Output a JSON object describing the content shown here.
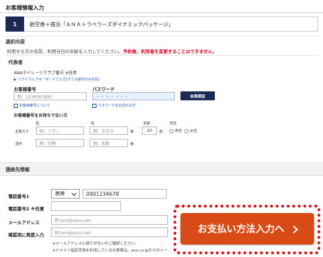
{
  "header": {
    "title": "お客様情報入力"
  },
  "step": {
    "number": "1",
    "label": "航空券＋宿泊「ＡＮＡトラベラーズダイナミックパッケージ」"
  },
  "selection": {
    "heading": "選択内容",
    "description": "利用する方の名前、利用当日の年齢を入力してください。",
    "warning": "予約後、利用者を変更することはできません。"
  },
  "representative": {
    "heading": "代表者",
    "amc_label": "ANAマイレージクラブ番号 ※任意",
    "keyboard_link": "ソフトウェアキーボードで入力(マウス操作のみ対応)",
    "member_number_label": "お客様番号",
    "member_number_placeholder": "例：1234567890",
    "password_label": "パスワード",
    "password_value": "・・・・・・・",
    "auth_button": "会員認証",
    "forgot_number_link": "お客様番号について",
    "forgot_password_link": "パスワードをお忘れの方",
    "no_number_label": "お客様番号をお持ちでない方",
    "col_last": "姓",
    "col_first": "名",
    "col_age": "年齢",
    "col_gender": "性別",
    "kana_label": "全角カナ",
    "kana_last_placeholder": "例：ソラノ",
    "kana_first_placeholder": "例：タロウ",
    "kanji_label": "漢字",
    "kanji_last_placeholder": "例：空野",
    "kanji_first_placeholder": "例：太郎",
    "age_value": "20",
    "age_unit": "歳",
    "honorific": "様",
    "gender_male": "男性",
    "gender_female": "女性"
  },
  "contact": {
    "heading": "連絡先情報",
    "phone1_label": "電話番号1",
    "phone_type": "携帯",
    "phone1_value": "0901234678",
    "phone2_label": "電話番号2 ※任意",
    "email_label": "メールアドレス",
    "email_value": "例 taro@sora.com",
    "email_confirm_label": "確認用に再度入力",
    "email_confirm_value": "例 taro@sora.com",
    "note1": "※メールアドレスに誤りがないかご確認ください。",
    "note2": "※ドメイン指定受信を利用しているお客様は、ana.co.jpからのメー"
  },
  "payment": {
    "button_label": "お支払い方法入力へ"
  },
  "colors": {
    "navy": "#1a2a55",
    "cta": "#d94b16",
    "highlight": "#e00000",
    "warning": "#d0021b"
  }
}
